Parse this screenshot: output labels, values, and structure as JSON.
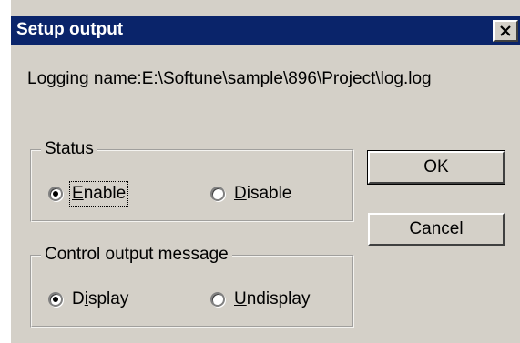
{
  "window": {
    "title": "Setup output",
    "close_icon": "close-icon"
  },
  "logging": {
    "text": "Logging name:E:\\Softune\\sample\\896\\Project\\log.log"
  },
  "status_group": {
    "legend": "Status",
    "options": [
      {
        "prefix": "",
        "accel": "E",
        "rest": "nable",
        "checked": true
      },
      {
        "prefix": "",
        "accel": "D",
        "rest": "isable",
        "checked": false
      }
    ]
  },
  "control_group": {
    "legend": "Control output message",
    "options": [
      {
        "prefix": "D",
        "accel": "i",
        "rest": "splay",
        "checked": true
      },
      {
        "prefix": "",
        "accel": "U",
        "rest": "ndisplay",
        "checked": false
      }
    ]
  },
  "buttons": {
    "ok": "OK",
    "cancel": "Cancel"
  },
  "colors": {
    "titlebar": "#0a246a",
    "face": "#d4d0c8"
  }
}
